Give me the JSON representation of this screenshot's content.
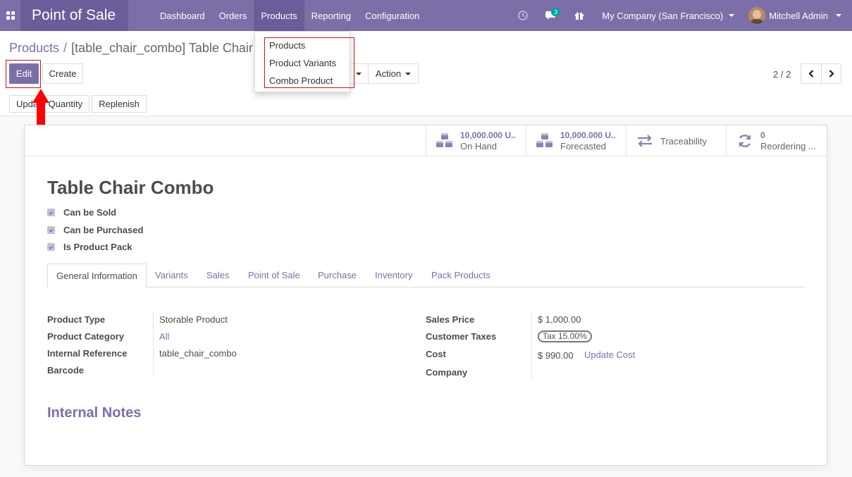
{
  "navbar": {
    "app_name": "Point of Sale",
    "menu": [
      "Dashboard",
      "Orders",
      "Products",
      "Reporting",
      "Configuration"
    ],
    "active_menu": "Products",
    "chat_count": "3",
    "company": "My Company (San Francisco)",
    "user": "Mitchell Admin",
    "icons": [
      "apps-icon",
      "clock-icon",
      "chat-icon",
      "gift-icon"
    ]
  },
  "breadcrumb": {
    "parent": "Products",
    "separator": "/",
    "current": "[table_chair_combo] Table Chair"
  },
  "buttons": {
    "edit": "Edit",
    "create": "Create",
    "action": "Action",
    "update_quantity": "Update Quantity",
    "replenish": "Replenish"
  },
  "pager": {
    "value": "2 / 2"
  },
  "dropdown": {
    "items": [
      "Products",
      "Product Variants",
      "Combo Product"
    ]
  },
  "stats": {
    "on_hand_value": "10,000.000 U..",
    "on_hand_label": "On Hand",
    "forecasted_value": "10,000.000 U..",
    "forecasted_label": "Forecasted",
    "traceability_label": "Traceability",
    "reordering_value": "0",
    "reordering_label": "Reordering ..."
  },
  "product": {
    "name": "Table Chair Combo",
    "checks": [
      "Can be Sold",
      "Can be Purchased",
      "Is Product Pack"
    ]
  },
  "tabs": [
    "General Information",
    "Variants",
    "Sales",
    "Point of Sale",
    "Purchase",
    "Inventory",
    "Pack Products"
  ],
  "left_fields": {
    "labels": [
      "Product Type",
      "Product Category",
      "Internal Reference",
      "Barcode"
    ],
    "product_type": "Storable Product",
    "product_category": "All",
    "internal_reference": "table_chair_combo"
  },
  "right_fields": {
    "labels": [
      "Sales Price",
      "Customer Taxes",
      "Cost",
      "Company"
    ],
    "sales_price": "$ 1,000.00",
    "customer_taxes": "Tax 15.00%",
    "cost": "$ 990.00",
    "update_cost": "Update Cost"
  },
  "sections": {
    "internal_notes": "Internal Notes"
  },
  "colors": {
    "brand": "#7c6fa8",
    "brand_dark": "#6a5d99",
    "highlight": "#c3121b",
    "arrow": "#ff0000"
  }
}
